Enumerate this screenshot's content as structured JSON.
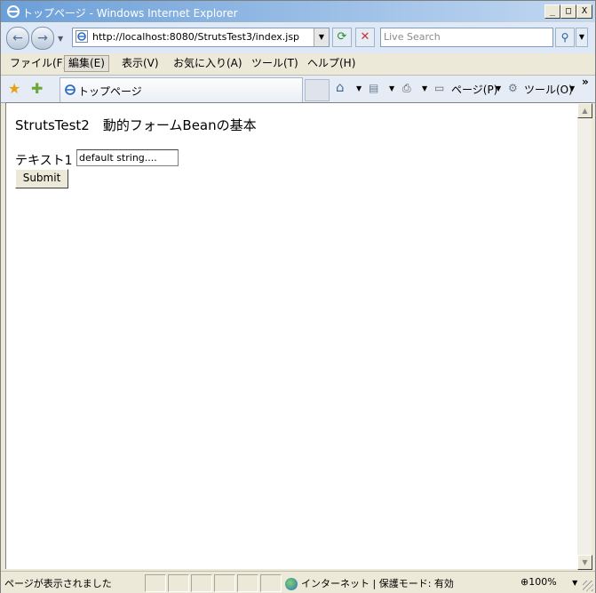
{
  "window": {
    "title": "トップページ - Windows Internet Explorer",
    "controls": {
      "minimize": "_",
      "maximize": "□",
      "close": "X"
    }
  },
  "toolbar": {
    "address": "http://localhost:8080/StrutsTest3/index.jsp",
    "search_placeholder": "Live Search",
    "back_icon": "back-arrow-icon",
    "forward_icon": "forward-arrow-icon",
    "refresh_icon": "refresh-icon",
    "stop_icon": "stop-icon",
    "search_icon": "magnifier-icon"
  },
  "menu": {
    "items": [
      "ファイル(F)",
      "編集(E)",
      "表示(V)",
      "お気に入り(A)",
      "ツール(T)",
      "ヘルプ(H)"
    ],
    "active": "編集(E)"
  },
  "tab": {
    "label": "トップページ"
  },
  "commands": {
    "page": "ページ(P)",
    "tools": "ツール(O)",
    "more": "»"
  },
  "page": {
    "heading": "StrutsTest2　動的フォームBeanの基本",
    "field_label": "テキスト1 :",
    "field_value": "default string....",
    "submit_label": "Submit"
  },
  "status": {
    "text": "ページが表示されました",
    "zone": "インターネット | 保護モード: 有効",
    "zoom": "100%"
  },
  "colors": {
    "titlebar": "#6b9fd8",
    "chrome": "#ece9d8",
    "content_bg": "#ffffff"
  }
}
